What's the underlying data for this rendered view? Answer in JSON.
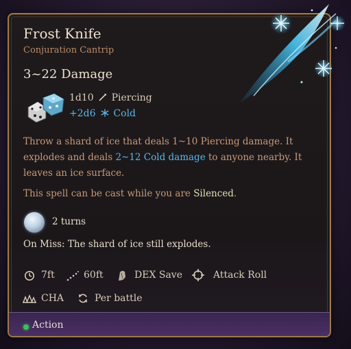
{
  "spell": {
    "name": "Frost Knife",
    "school": "Conjuration Cantrip",
    "damage_summary": "3~22 Damage",
    "dice": {
      "primary_roll": "1d10",
      "primary_type": "Piercing",
      "secondary_roll": "+2d6",
      "secondary_type": "Cold"
    },
    "description": {
      "part1": "Throw a shard of ice that deals 1~10 Piercing damage. It explodes and deals ",
      "highlight": "2~12 Cold damage",
      "part2": " to anyone nearby. It leaves an ice surface."
    },
    "silence_note": {
      "prefix": "This spell can be cast while you are ",
      "highlight": "Silenced",
      "suffix": "."
    },
    "duration": "2 turns",
    "on_miss": "On Miss: The shard of ice still explodes.",
    "properties": {
      "range": "7ft",
      "aoe": "60ft",
      "save": "DEX Save",
      "attack": "Attack Roll",
      "ability": "CHA",
      "recharge": "Per battle"
    },
    "cost": "Action"
  },
  "colors": {
    "title": "#eee2cf",
    "subtitle": "#b98b68",
    "cold_blue": "#5ab7e9",
    "border_gold": "#9c7a4c",
    "action_green": "#3bbf5a",
    "footer_purple": "#4a2f63"
  },
  "icons": [
    "pierce-icon",
    "snowflake-icon",
    "clock-icon",
    "aoe-dotted-icon",
    "dex-save-icon",
    "crosshair-icon",
    "cha-icon",
    "refresh-icon",
    "turn-ice-icon",
    "dice-icon",
    "frost-shard-icon"
  ]
}
